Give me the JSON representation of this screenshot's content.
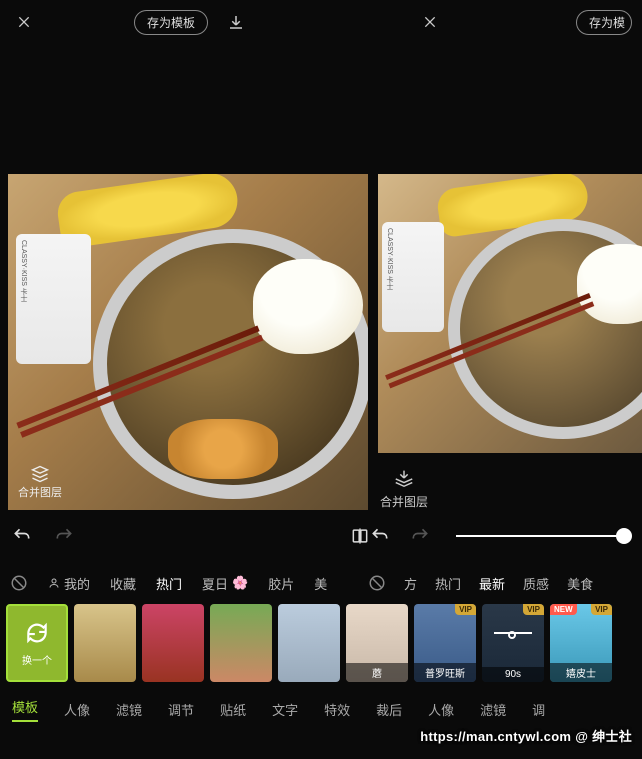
{
  "topbar": {
    "save_template": "存为模板",
    "save_template2": "存为模"
  },
  "merge": {
    "left_label": "合并图层",
    "right_label": "合并图层"
  },
  "yogurt_brand": "CLASSY·KISS 卡士",
  "categories_left": {
    "mine": "我的",
    "fav": "收藏",
    "hot": "热门",
    "summer": "夏日",
    "film": "胶片",
    "beauty": "美"
  },
  "categories_right": {
    "fang": "方",
    "hot": "热门",
    "newest": "最新",
    "texture": "质感",
    "food": "美食"
  },
  "thumbs": {
    "refresh": "换一个",
    "mo": "蘑",
    "provence": "普罗旺斯",
    "nineties": "90s",
    "pishi": "嬉皮士",
    "vip": "VIP",
    "new": "NEW"
  },
  "bottom_tabs": [
    "模板",
    "人像",
    "滤镜",
    "调节",
    "贴纸",
    "文字",
    "特效",
    "裁后",
    "人像",
    "滤镜",
    "调"
  ],
  "watermark": "https://man.cntywl.com @ 绅士社"
}
